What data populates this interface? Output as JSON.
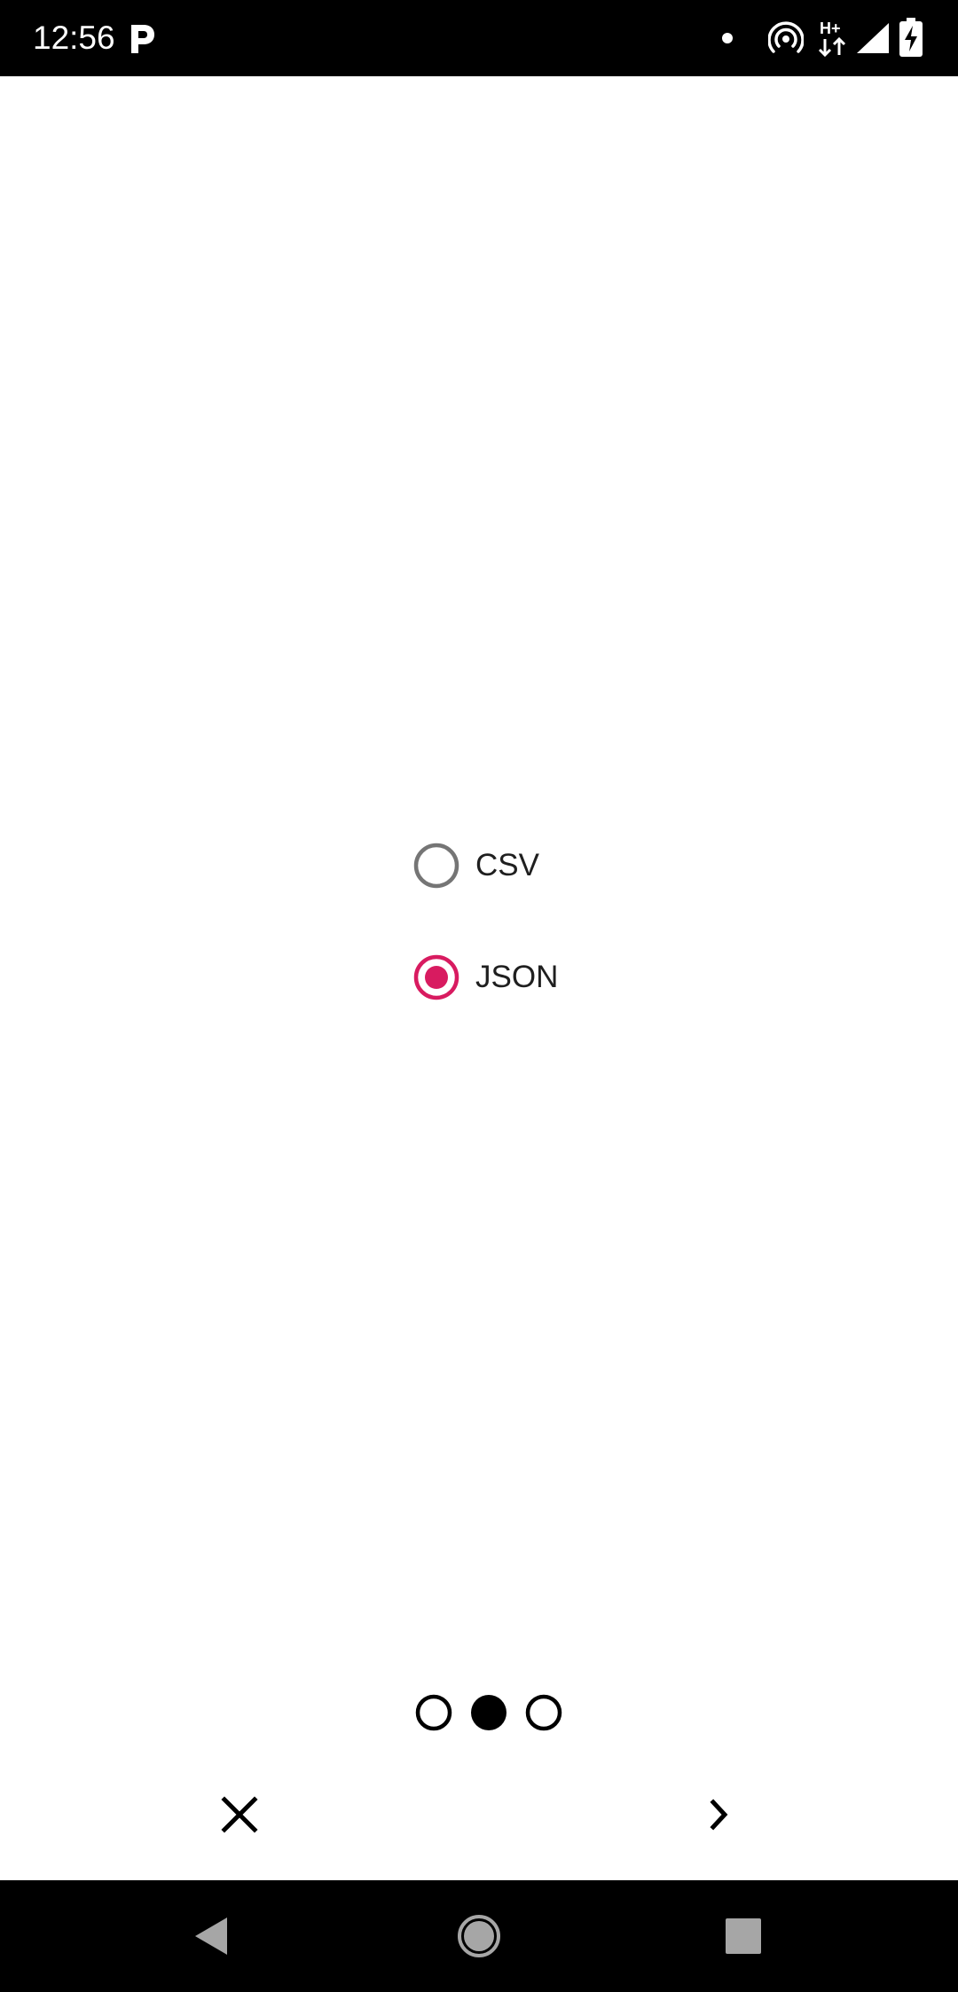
{
  "status_bar": {
    "time": "12:56",
    "icons": [
      "parking-icon",
      "dot-icon",
      "hotspot-icon",
      "network-hplus-icon",
      "signal-icon",
      "battery-charging-icon"
    ],
    "network_label": "H+"
  },
  "format_options": {
    "options": [
      {
        "label": "CSV",
        "selected": false
      },
      {
        "label": "JSON",
        "selected": true
      }
    ],
    "accent_color": "#d81b60",
    "unselected_color": "#757575"
  },
  "pager": {
    "page_count": 3,
    "current_page": 2
  },
  "actions": {
    "close_icon": "close-icon",
    "next_icon": "chevron-right-icon"
  },
  "nav_bar": {
    "icons": [
      "back-icon",
      "home-icon",
      "recents-icon"
    ]
  }
}
